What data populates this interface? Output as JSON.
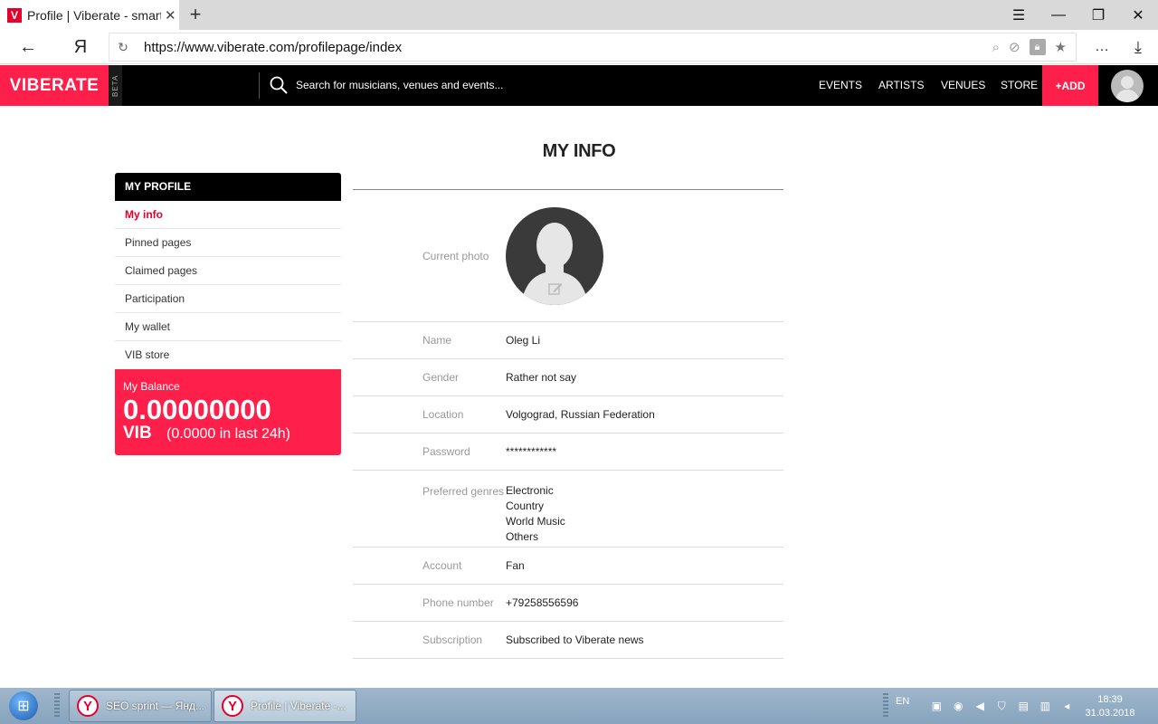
{
  "browser": {
    "tab_title": "Profile | Viberate - smarte",
    "tab_favicon_letter": "V",
    "new_tab": "+",
    "url": "https://www.viberate.com/profilepage/index",
    "back_glyph": "←",
    "yandex_glyph": "Я",
    "menu_glyph": "…"
  },
  "site": {
    "logo": "VIBERATE",
    "beta": "BETA",
    "search_placeholder": "Search for musicians, venues and events...",
    "nav": [
      "EVENTS",
      "ARTISTS",
      "VENUES",
      "STORE"
    ],
    "add": "+ADD",
    "accent_color": "#ff1f4b"
  },
  "page": {
    "title": "MY INFO"
  },
  "sidebar": {
    "header": "MY PROFILE",
    "items": [
      {
        "label": "My info",
        "active": true
      },
      {
        "label": "Pinned pages",
        "active": false
      },
      {
        "label": "Claimed pages",
        "active": false
      },
      {
        "label": "Participation",
        "active": false
      },
      {
        "label": "My wallet",
        "active": false
      },
      {
        "label": "VIB store",
        "active": false
      }
    ],
    "balance": {
      "label": "My Balance",
      "value": "0.00000000",
      "unit": "VIB",
      "last24": "(0.0000 in last 24h)"
    }
  },
  "info": {
    "photo_label": "Current photo",
    "name_label": "Name",
    "name": "Oleg Li",
    "gender_label": "Gender",
    "gender": "Rather not say",
    "location_label": "Location",
    "location": "Volgograd, Russian Federation",
    "password_label": "Password",
    "password": "************",
    "genres_label": "Preferred genres",
    "genres": [
      "Electronic",
      "Country",
      "World Music",
      "Others"
    ],
    "account_label": "Account",
    "account": "Fan",
    "phone_label": "Phone number",
    "phone": "+79258556596",
    "subscription_label": "Subscription",
    "subscription": "Subscribed to Viberate news"
  },
  "taskbar": {
    "tasks": [
      {
        "label": "SEO sprint — Янд..."
      },
      {
        "label": "Profile | Viberate -..."
      }
    ],
    "lang": "EN",
    "time": "18:39",
    "date": "31.03.2018"
  }
}
